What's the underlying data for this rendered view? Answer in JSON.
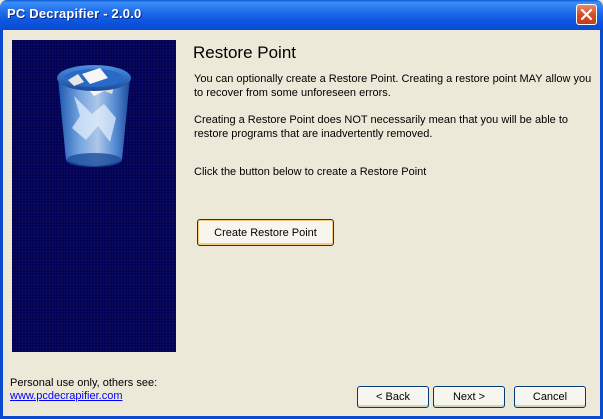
{
  "window": {
    "title": "PC Decrapifier - 2.0.0",
    "close_icon": "close-icon"
  },
  "side_panel": {
    "icon": "recycle-bin-icon"
  },
  "content": {
    "heading": "Restore Point",
    "paragraph1": "You can optionally create a Restore Point.  Creating a restore point MAY allow you to recover from some unforeseen errors.",
    "paragraph2": "Creating a Restore Point does NOT necessarily mean that you will be able to restore programs that are inadvertently removed.",
    "paragraph3": "Click the button below to create a Restore Point",
    "create_button": "Create Restore Point"
  },
  "footer": {
    "note": "Personal use only, others see:",
    "link": "www.pcdecrapifier.com",
    "back_button": "< Back",
    "next_button": "Next >",
    "cancel_button": "Cancel"
  },
  "colors": {
    "titlebar": "#0a4ad0",
    "background": "#ece9d8",
    "panel": "#03034a",
    "link": "#0000ff"
  }
}
